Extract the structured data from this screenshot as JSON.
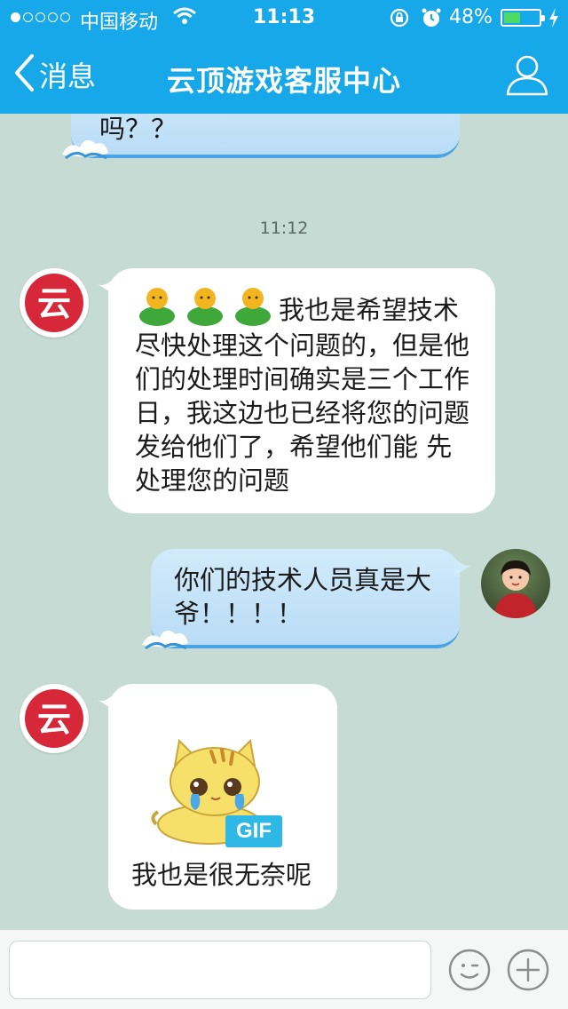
{
  "status_bar": {
    "carrier": "中国移动",
    "time": "11:13",
    "battery_percent": "48%",
    "battery_level": 0.48,
    "signal_bars_filled": 1,
    "signal_bars_total": 5
  },
  "nav": {
    "back_label": "消息",
    "title": "云顶游戏客服中心",
    "accent_color": "#16a8e8"
  },
  "messages": {
    "partial_out_text": "吗？？",
    "timestamp": "11:12",
    "support_message": {
      "line1": "我也是希望技术",
      "rest": "尽快处理这个问题的，但是他们的处理时间确实是三个工作日，我这边也已经将您的问题发给他们了，希望他们能 先处理您的问题"
    },
    "user_message": "你们的技术人员真是大爷！！！！",
    "gif_message": {
      "badge": "GIF",
      "caption": "我也是很无奈呢"
    }
  },
  "input_bar": {
    "placeholder": "",
    "emoji_icon": "smiley-icon",
    "plus_icon": "plus-icon"
  },
  "avatars": {
    "support_logo_char": "云"
  }
}
